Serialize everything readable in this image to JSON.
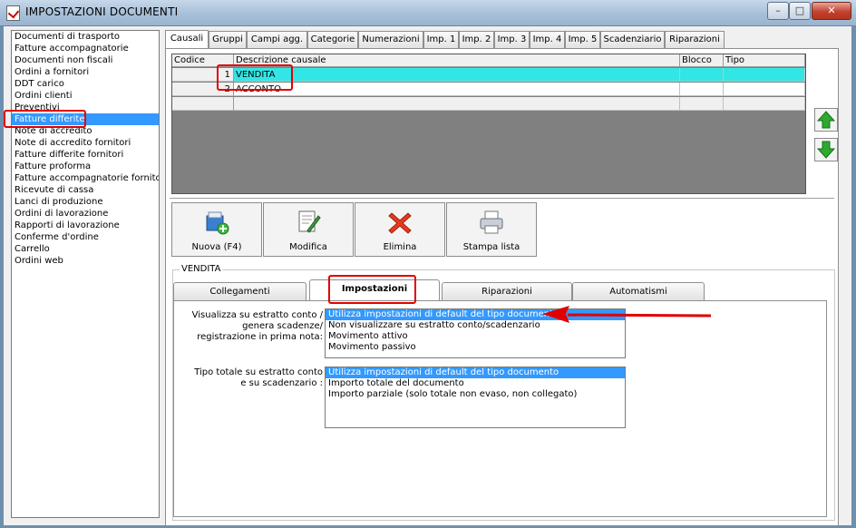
{
  "window": {
    "title": "IMPOSTAZIONI DOCUMENTI",
    "min_glyph": "–",
    "max_glyph": "□",
    "close_glyph": "✕"
  },
  "doc_types": [
    "Documenti di trasporto",
    "Fatture accompagnatorie",
    "Documenti non fiscali",
    "Ordini a fornitori",
    "DDT carico",
    "Ordini clienti",
    "Preventivi",
    "Fatture differite",
    "Note di accredito",
    "Note di accredito fornitori",
    "Fatture differite fornitori",
    "Fatture proforma",
    "Fatture accompagnatorie fornitori",
    "Ricevute di cassa",
    "Lanci di produzione",
    "Ordini di lavorazione",
    "Rapporti di lavorazione",
    "Conferme d'ordine",
    "Carrello",
    "Ordini web"
  ],
  "selected_doc_type": "Fatture differite",
  "tabs": [
    "Causali",
    "Gruppi",
    "Campi agg.",
    "Categorie",
    "Numerazioni",
    "Imp. 1",
    "Imp. 2",
    "Imp. 3",
    "Imp. 4",
    "Imp. 5",
    "Scadenziario",
    "Riparazioni"
  ],
  "active_tab": "Causali",
  "grid": {
    "columns": [
      "Codice",
      "Descrizione causale",
      "Blocco",
      "Tipo"
    ],
    "rows": [
      {
        "codice": "1",
        "descrizione": "VENDITA",
        "blocco": "",
        "tipo": ""
      },
      {
        "codice": "2",
        "descrizione": "ACCONTO",
        "blocco": "",
        "tipo": ""
      }
    ],
    "selected_row": "VENDITA"
  },
  "toolbar": {
    "nuova": "Nuova (F4)",
    "modifica": "Modifica",
    "elimina": "Elimina",
    "stampa": "Stampa lista"
  },
  "group_caption": "VENDITA",
  "subtabs": [
    "Collegamenti",
    "Impostazioni",
    "Riparazioni",
    "Automatismi"
  ],
  "active_subtab": "Impostazioni",
  "estratto": {
    "label_lines": [
      "Visualizza su estratto conto /",
      "genera scadenze/",
      "registrazione  in prima nota:"
    ],
    "options": [
      "Utilizza impostazioni di default del tipo documento",
      "Non visualizzare su estratto conto/scadenzario",
      "Movimento attivo",
      "Movimento passivo"
    ],
    "selected": "Utilizza impostazioni di default del tipo documento"
  },
  "tipo_totale": {
    "label_lines": [
      "Tipo totale su estratto conto",
      "e su scadenzario :"
    ],
    "options": [
      "Utilizza impostazioni di default del tipo documento",
      "Importo totale del documento",
      "Importo parziale (solo totale non evaso, non collegato)"
    ],
    "selected": "Utilizza impostazioni di default del tipo documento"
  },
  "colors": {
    "selection": "#3399ff",
    "grid_selection": "#33e6e6",
    "highlight": "#e00000",
    "arrow_green": "#2eaa2e"
  }
}
